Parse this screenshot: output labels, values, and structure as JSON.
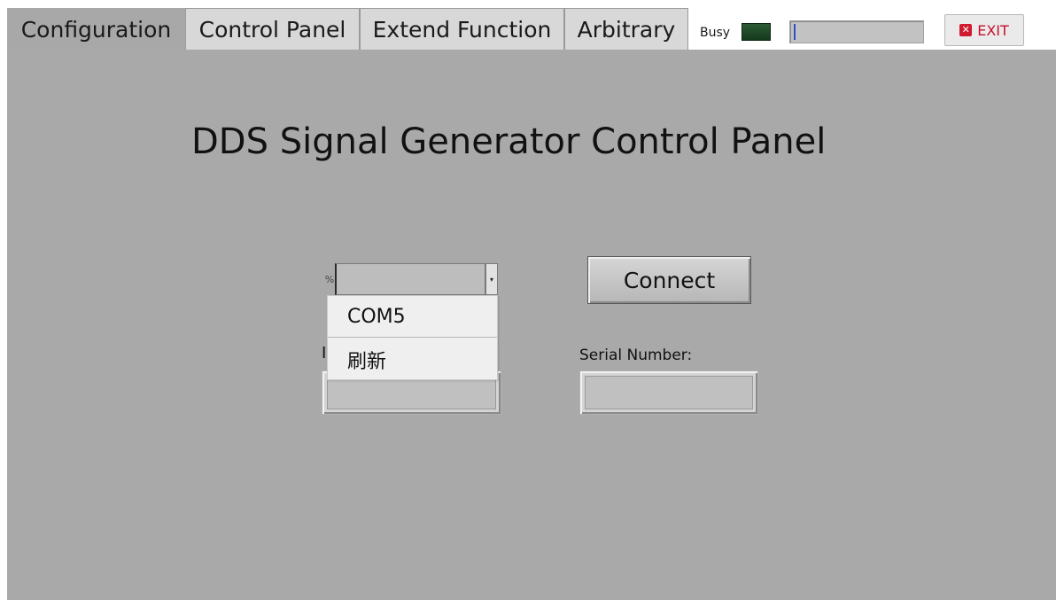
{
  "tabs": [
    {
      "label": "Configuration",
      "active": true
    },
    {
      "label": "Control Panel",
      "active": false
    },
    {
      "label": "Extend Function",
      "active": false
    },
    {
      "label": "Arbitrary",
      "active": false
    }
  ],
  "status": {
    "busy_label": "Busy",
    "busy_led_color": "#1e4a27",
    "progress_percent": 1
  },
  "exit_button": {
    "label": "EXIT",
    "icon": "close-x-icon",
    "color": "#c8102e"
  },
  "panel": {
    "title": "DDS Signal Generator Control Panel",
    "port_combo": {
      "value": "",
      "indicator": "%",
      "arrow": "▾"
    },
    "port_dropdown": {
      "items": [
        "COM5",
        "刷新"
      ]
    },
    "hidden_label": "I",
    "connect_label": "Connect",
    "serial_label": "Serial Number:",
    "serial_value": "",
    "model_value": ""
  },
  "colors": {
    "panel_bg": "#a9a9a9",
    "tab_inactive_bg": "#d8d8d8",
    "progress_fill": "#2a4ec7"
  }
}
